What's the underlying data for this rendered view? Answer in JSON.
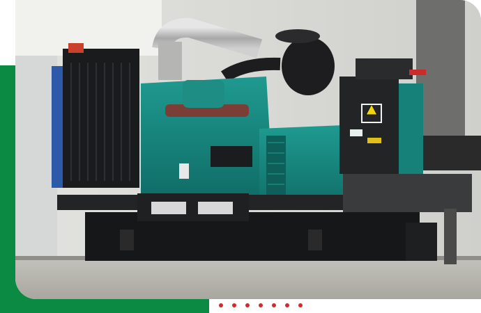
{
  "photo": {
    "subject": "generator-set",
    "colors": {
      "accent": "#0b8a43",
      "engine_teal": "#157f78",
      "frame_black": "#1b1c1e",
      "wall": "#d9d9d5",
      "floor": "#b9b8b2",
      "dots": "#d62a2a"
    }
  },
  "decor": {
    "dot_count": 7
  }
}
